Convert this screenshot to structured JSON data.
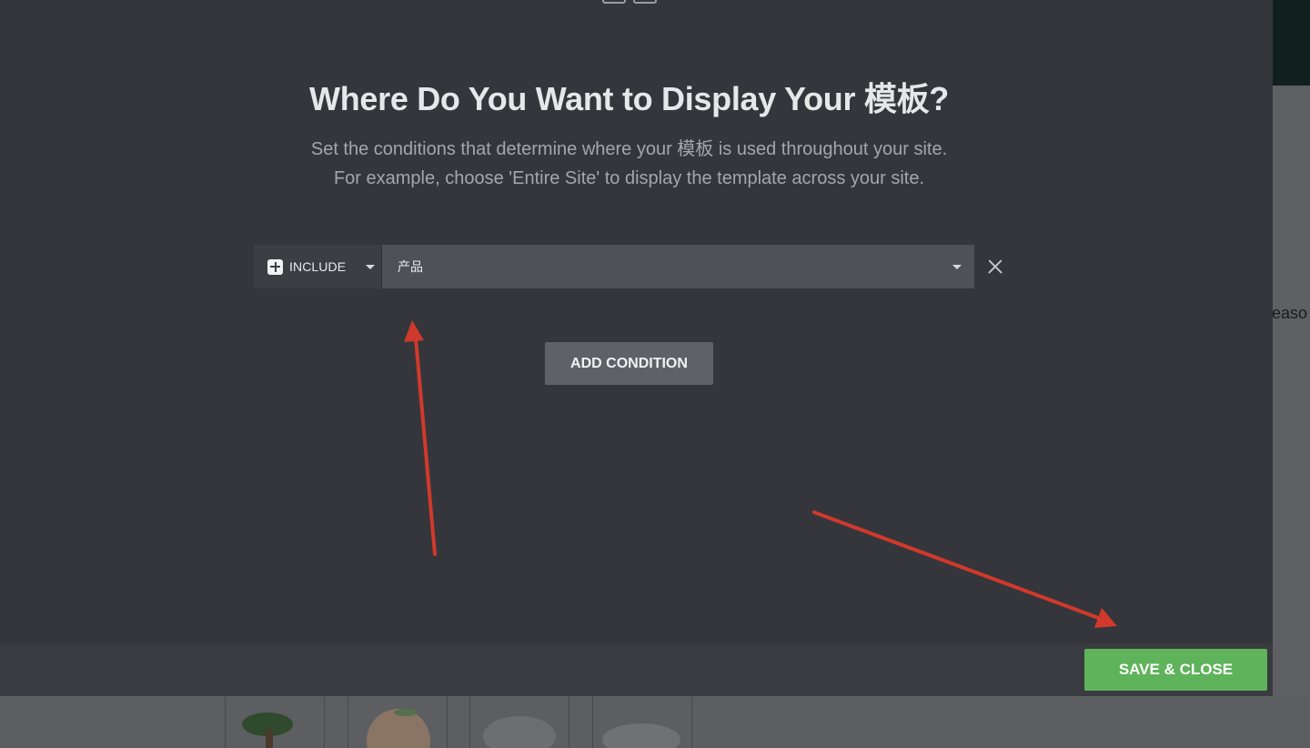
{
  "background": {
    "partial_text": "easo"
  },
  "modal": {
    "title": "Where Do You Want to Display Your 模板?",
    "description_line1": "Set the conditions that determine where your 模板 is used throughout your site.",
    "description_line2": "For example, choose 'Entire Site' to display the template across your site.",
    "condition": {
      "type_label": "INCLUDE",
      "value_label": "产品"
    },
    "add_condition_label": "ADD CONDITION",
    "save_label": "SAVE & CLOSE"
  },
  "colors": {
    "modal_bg": "#34363b",
    "save_green": "#5eb35b",
    "arrow_red": "#d1392c"
  },
  "icons": [
    "plus-icon",
    "chevron-down-icon",
    "close-icon"
  ]
}
